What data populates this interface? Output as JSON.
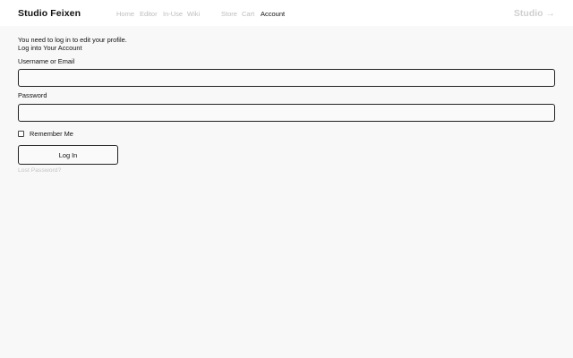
{
  "header": {
    "brand": "Studio Feixen",
    "nav": [
      {
        "label": "Home",
        "active": false
      },
      {
        "label": "Editor",
        "active": false
      },
      {
        "label": "In-Use",
        "active": false
      },
      {
        "label": "Wiki",
        "active": false
      },
      {
        "label": "Store",
        "active": false
      },
      {
        "label": "Cart",
        "active": false
      },
      {
        "label": "Account",
        "active": true
      }
    ],
    "studio_link": "Studio",
    "studio_arrow": "→"
  },
  "main": {
    "notice": "You need to log in to edit your profile.",
    "subtitle": "Log into Your Account",
    "username_label": "Username or Email",
    "username_value": "",
    "password_label": "Password",
    "password_value": "",
    "remember_label": "Remember Me",
    "login_button": "Log In",
    "lost_password": "Lost Password?"
  },
  "colors": {
    "background": "#f8f8f8",
    "header_bg": "#ffffff",
    "text": "#111111",
    "muted": "#bdbdbd"
  }
}
